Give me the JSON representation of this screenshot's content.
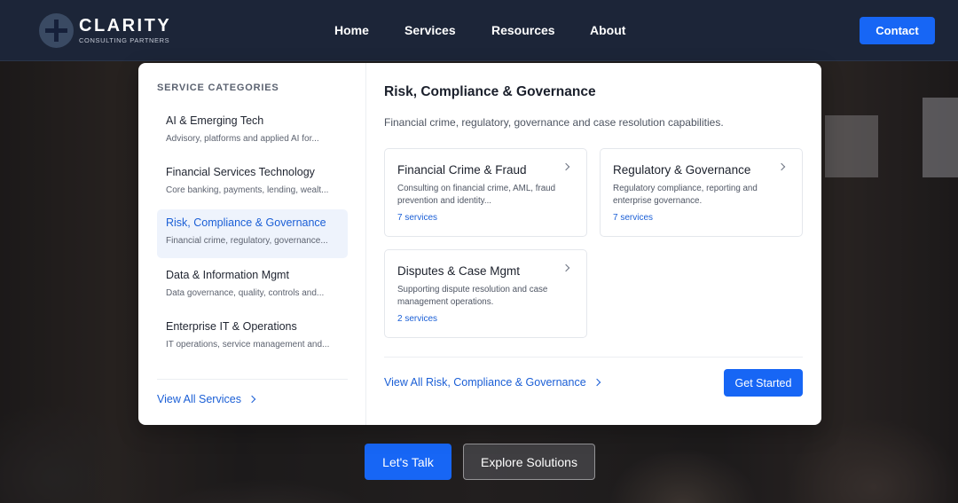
{
  "brand": {
    "name": "CLARITY",
    "subtitle": "CONSULTING PARTNERS"
  },
  "nav": {
    "links": [
      "Home",
      "Services",
      "Resources",
      "About"
    ],
    "contact_label": "Contact"
  },
  "mega_menu": {
    "categories_heading": "SERVICE CATEGORIES",
    "categories": [
      {
        "title": "AI & Emerging Tech",
        "description": "Advisory, platforms and applied AI for..."
      },
      {
        "title": "Financial Services Technology",
        "description": "Core banking, payments, lending, wealt..."
      },
      {
        "title": "Risk, Compliance & Governance",
        "description": "Financial crime, regulatory, governance...",
        "active": true
      },
      {
        "title": "Data & Information Mgmt",
        "description": "Data governance, quality, controls and..."
      },
      {
        "title": "Enterprise IT & Operations",
        "description": "IT operations, service management and..."
      }
    ],
    "view_all_services": "View All Services",
    "panel": {
      "title": "Risk, Compliance & Governance",
      "description": "Financial crime, regulatory, governance and case resolution capabilities.",
      "services": [
        {
          "title": "Financial Crime & Fraud",
          "description": "Consulting on financial crime, AML, fraud prevention and identity...",
          "count": "7 services"
        },
        {
          "title": "Regulatory & Governance",
          "description": "Regulatory compliance, reporting and enterprise governance.",
          "count": "7 services"
        },
        {
          "title": "Disputes & Case Mgmt",
          "description": "Supporting dispute resolution and case management operations.",
          "count": "2 services"
        }
      ],
      "view_all_label": "View All Risk, Compliance & Governance",
      "cta_label": "Get Started"
    }
  },
  "hero": {
    "primary_cta": "Let's Talk",
    "secondary_cta": "Explore Solutions"
  },
  "colors": {
    "accent": "#1766f5",
    "nav_bg": "#1c2538",
    "link": "#1b5fd6",
    "active_bg": "#eef3fc"
  }
}
